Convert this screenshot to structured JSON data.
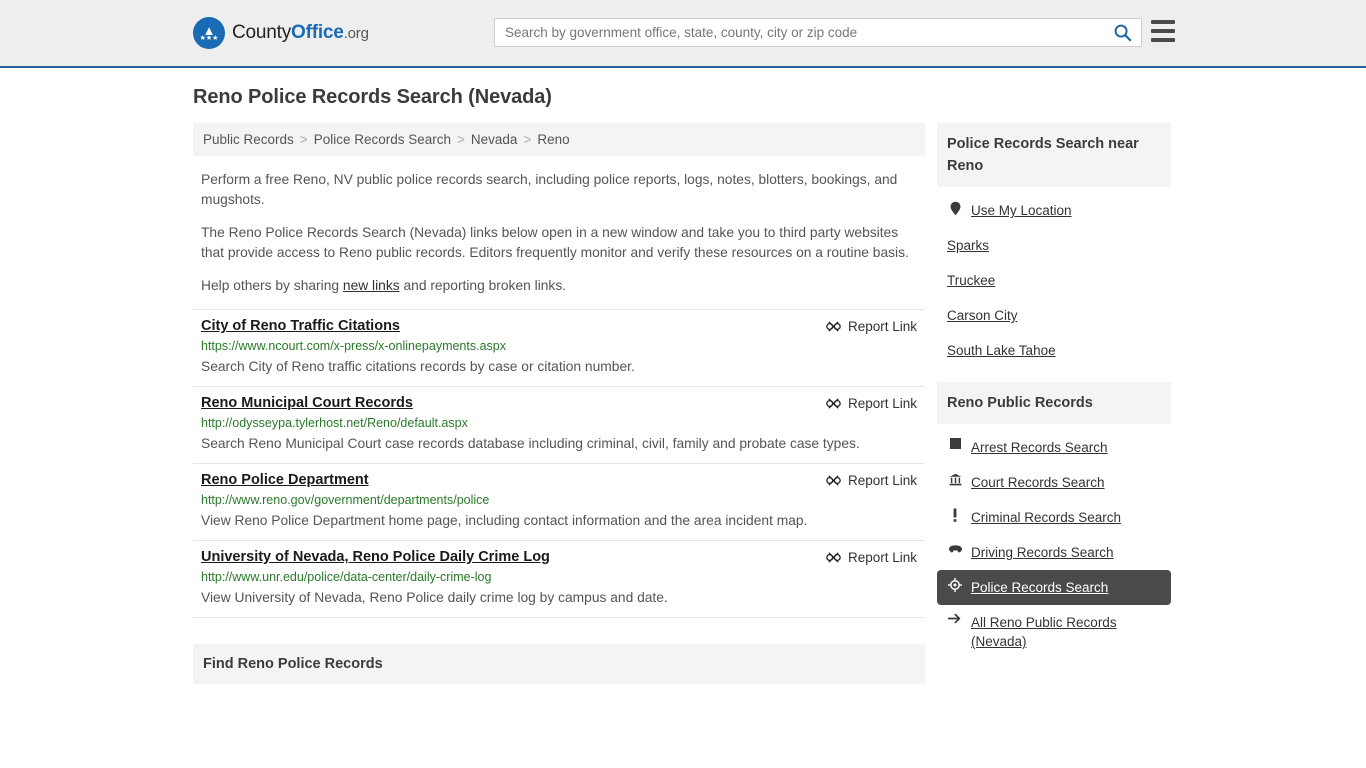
{
  "header": {
    "brand": {
      "county": "County",
      "office": "Office",
      "org": ".org"
    },
    "search": {
      "placeholder": "Search by government office, state, county, city or zip code",
      "value": ""
    },
    "search_icon": "search-icon",
    "menu_icon": "hamburger-menu-icon",
    "accent_color": "#2a6099",
    "background": "#eeeeee"
  },
  "page": {
    "title": "Reno Police Records Search (Nevada)"
  },
  "breadcrumb": {
    "separator": ">",
    "items": [
      {
        "label": "Public Records"
      },
      {
        "label": "Police Records Search"
      },
      {
        "label": "Nevada"
      },
      {
        "label": "Reno"
      }
    ]
  },
  "intro": {
    "p1": "Perform a free Reno, NV public police records search, including police reports, logs, notes, blotters, bookings, and mugshots.",
    "p2": "The Reno Police Records Search (Nevada) links below open in a new window and take you to third party websites that provide access to Reno public records. Editors frequently monitor and verify these resources on a routine basis.",
    "p3_before": "Help others by sharing ",
    "p3_link": "new links",
    "p3_after": " and reporting broken links."
  },
  "results": {
    "report_label": "Report Link",
    "report_icon": "broken-link-icon",
    "url_color": "#2a7a2a",
    "items": [
      {
        "title": "City of Reno Traffic Citations",
        "url": "https://www.ncourt.com/x-press/x-onlinepayments.aspx",
        "description": "Search City of Reno traffic citations records by case or citation number."
      },
      {
        "title": "Reno Municipal Court Records",
        "url": "http://odysseypa.tylerhost.net/Reno/default.aspx",
        "description": "Search Reno Municipal Court case records database including criminal, civil, family and probate case types."
      },
      {
        "title": "Reno Police Department",
        "url": "http://www.reno.gov/government/departments/police",
        "description": "View Reno Police Department home page, including contact information and the area incident map."
      },
      {
        "title": "University of Nevada, Reno Police Daily Crime Log",
        "url": "http://www.unr.edu/police/data-center/daily-crime-log",
        "description": "View University of Nevada, Reno Police daily crime log by campus and date."
      }
    ]
  },
  "find_section": {
    "title": "Find Reno Police Records"
  },
  "sidebar": {
    "nearby": {
      "title": "Police Records Search near Reno",
      "items": [
        {
          "label": "Use My Location",
          "icon": "location-pin-icon",
          "has_icon": true
        },
        {
          "label": "Sparks",
          "icon": "",
          "has_icon": false
        },
        {
          "label": "Truckee",
          "icon": "",
          "has_icon": false
        },
        {
          "label": "Carson City",
          "icon": "",
          "has_icon": false
        },
        {
          "label": "South Lake Tahoe",
          "icon": "",
          "has_icon": false
        }
      ]
    },
    "public_records": {
      "title": "Reno Public Records",
      "active_background": "#4a4a4a",
      "items": [
        {
          "label": "Arrest Records Search",
          "icon": "arrest-square-icon",
          "active": false
        },
        {
          "label": "Court Records Search",
          "icon": "courthouse-icon",
          "active": false
        },
        {
          "label": "Criminal Records Search",
          "icon": "exclamation-icon",
          "active": false
        },
        {
          "label": "Driving Records Search",
          "icon": "car-icon",
          "active": false
        },
        {
          "label": "Police Records Search",
          "icon": "police-badge-icon",
          "active": true
        },
        {
          "label": "All Reno Public Records (Nevada)",
          "icon": "arrow-right-icon",
          "active": false
        }
      ]
    }
  }
}
